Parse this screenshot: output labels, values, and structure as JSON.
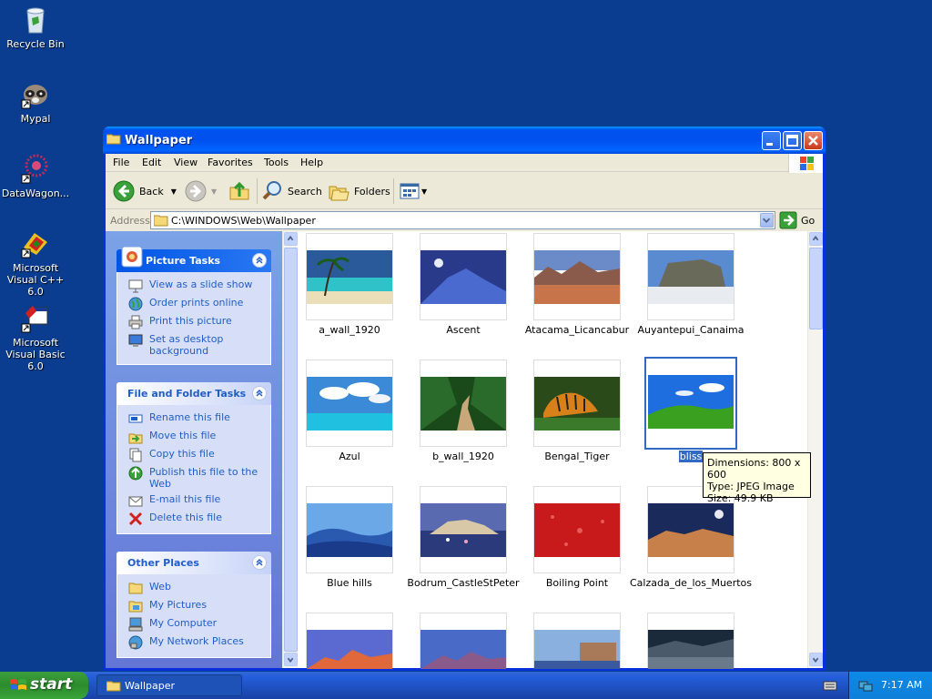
{
  "desktop": {
    "icons": [
      {
        "label": "Recycle Bin"
      },
      {
        "label": "Mypal"
      },
      {
        "label": "DataWagon..."
      },
      {
        "label": "Microsoft Visual C++ 6.0"
      },
      {
        "label": "Microsoft Visual Basic 6.0"
      }
    ]
  },
  "window": {
    "title": "Wallpaper",
    "menu": [
      "File",
      "Edit",
      "View",
      "Favorites",
      "Tools",
      "Help"
    ],
    "toolbar": {
      "back": "Back",
      "search": "Search",
      "folders": "Folders"
    },
    "address": {
      "label": "Address",
      "path": "C:\\WINDOWS\\Web\\Wallpaper",
      "go": "Go"
    }
  },
  "leftpane": {
    "picture_tasks": {
      "title": "Picture Tasks",
      "items": [
        "View as a slide show",
        "Order prints online",
        "Print this picture",
        "Set as desktop background"
      ]
    },
    "file_folder_tasks": {
      "title": "File and Folder Tasks",
      "items": [
        "Rename this file",
        "Move this file",
        "Copy this file",
        "Publish this file to the Web",
        "E-mail this file",
        "Delete this file"
      ]
    },
    "other_places": {
      "title": "Other Places",
      "items": [
        "Web",
        "My Pictures",
        "My Computer",
        "My Network Places"
      ]
    }
  },
  "files": [
    {
      "name": "a_wall_1920"
    },
    {
      "name": "Ascent"
    },
    {
      "name": "Atacama_Licancabur"
    },
    {
      "name": "Auyantepui_Canaima"
    },
    {
      "name": "Azul"
    },
    {
      "name": "b_wall_1920"
    },
    {
      "name": "Bengal_Tiger"
    },
    {
      "name": "bliss",
      "selected": true
    },
    {
      "name": "Blue hills"
    },
    {
      "name": "Bodrum_CastleStPeter"
    },
    {
      "name": "Boiling Point"
    },
    {
      "name": "Calzada_de_los_Muertos"
    }
  ],
  "tooltip": {
    "dimensions": "Dimensions: 800 x 600",
    "type": "Type: JPEG Image",
    "size": "Size: 49.9 KB"
  },
  "taskbar": {
    "start": "start",
    "task": "Wallpaper",
    "clock": "7:17 AM"
  },
  "colors": {
    "desktop": "#0a3d8f",
    "selection": "#316ac5",
    "task_link": "#215dc6"
  }
}
